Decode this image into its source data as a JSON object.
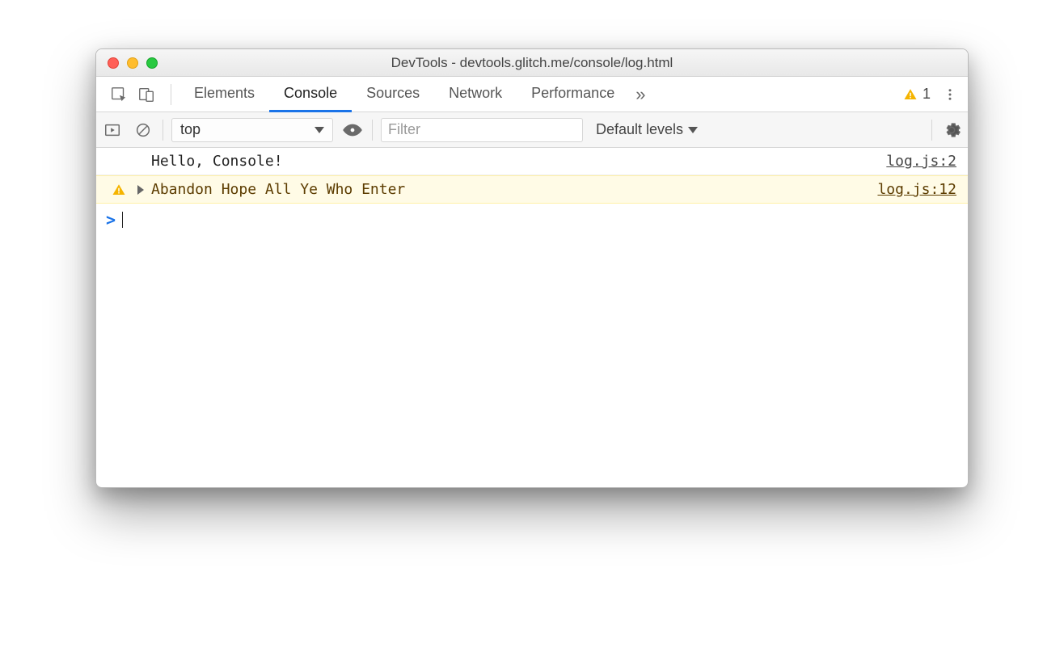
{
  "window": {
    "title": "DevTools - devtools.glitch.me/console/log.html"
  },
  "tabs": {
    "items": [
      "Elements",
      "Console",
      "Sources",
      "Network",
      "Performance"
    ],
    "active": "Console",
    "more_glyph": "»",
    "warning_count": "1"
  },
  "filterbar": {
    "context": "top",
    "filter_placeholder": "Filter",
    "filter_value": "",
    "levels_label": "Default levels"
  },
  "console": {
    "rows": [
      {
        "type": "log",
        "message": "Hello, Console!",
        "source": "log.js:2"
      },
      {
        "type": "warn",
        "message": "Abandon Hope All Ye Who Enter",
        "source": "log.js:12"
      }
    ],
    "prompt": ">"
  }
}
